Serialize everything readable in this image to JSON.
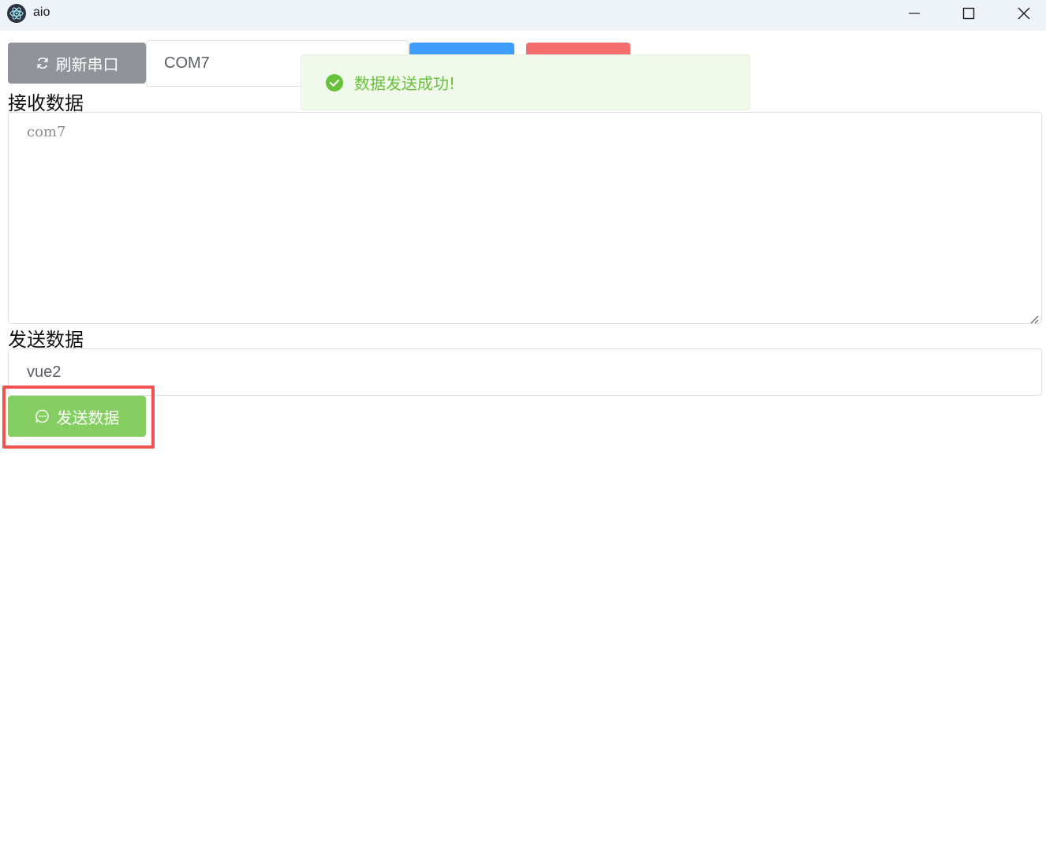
{
  "window": {
    "title": "aio",
    "icon": "electron-logo-icon"
  },
  "toolbar": {
    "refresh_label": "刷新串口",
    "refresh_icon": "refresh-icon",
    "port_value": "COM7",
    "blue_button_label": "",
    "red_button_label": ""
  },
  "toast": {
    "message": "数据发送成功!",
    "icon": "success-check-icon"
  },
  "receive": {
    "label": "接收数据",
    "content": "com7"
  },
  "send": {
    "label": "发送数据",
    "input_value": "vue2",
    "button_label": "发送数据",
    "button_icon": "chat-bubble-icon"
  },
  "colors": {
    "refresh_button": "#909399",
    "primary_button": "#409eff",
    "danger_button": "#f56c6c",
    "success_button": "#85ce61",
    "toast_background": "#f0f9eb",
    "toast_text": "#67c23a",
    "highlight_border": "#ef5350"
  }
}
